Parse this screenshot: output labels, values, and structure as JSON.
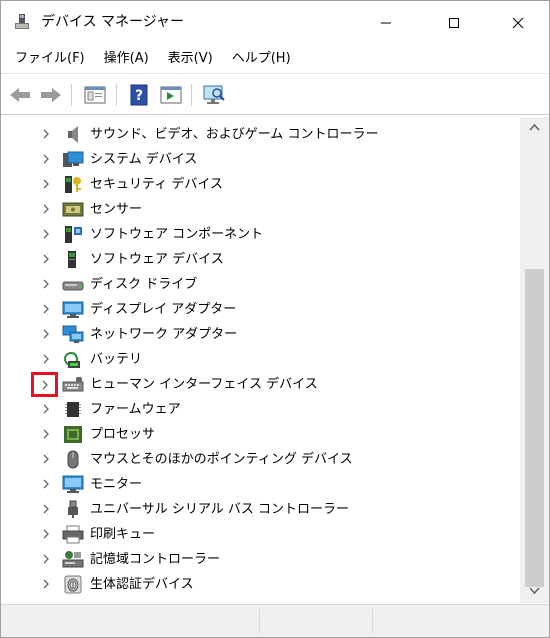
{
  "window": {
    "title": "デバイス マネージャー"
  },
  "menu": [
    {
      "label": "ファイル(F)"
    },
    {
      "label": "操作(A)"
    },
    {
      "label": "表示(V)"
    },
    {
      "label": "ヘルプ(H)"
    }
  ],
  "toolbar": {
    "buttons": [
      "back-icon",
      "forward-icon",
      "properties-icon",
      "help-icon",
      "run-icon",
      "scan-hardware-icon"
    ]
  },
  "tree": {
    "items": [
      {
        "label": "サウンド、ビデオ、およびゲーム コントローラー",
        "icon": "speaker-icon"
      },
      {
        "label": "システム デバイス",
        "icon": "system-device-icon"
      },
      {
        "label": "セキュリティ デバイス",
        "icon": "security-key-icon"
      },
      {
        "label": "センサー",
        "icon": "sensor-icon"
      },
      {
        "label": "ソフトウェア コンポーネント",
        "icon": "software-component-icon"
      },
      {
        "label": "ソフトウェア デバイス",
        "icon": "software-device-icon"
      },
      {
        "label": "ディスク ドライブ",
        "icon": "disk-drive-icon"
      },
      {
        "label": "ディスプレイ アダプター",
        "icon": "display-adapter-icon"
      },
      {
        "label": "ネットワーク アダプター",
        "icon": "network-adapter-icon"
      },
      {
        "label": "バッテリ",
        "icon": "battery-icon"
      },
      {
        "label": "ヒューマン インターフェイス デバイス",
        "icon": "hid-keyboard-icon",
        "highlighted": true
      },
      {
        "label": "ファームウェア",
        "icon": "firmware-chip-icon"
      },
      {
        "label": "プロセッサ",
        "icon": "processor-icon"
      },
      {
        "label": "マウスとそのほかのポインティング デバイス",
        "icon": "mouse-icon"
      },
      {
        "label": "モニター",
        "icon": "monitor-icon"
      },
      {
        "label": "ユニバーサル シリアル バス コントローラー",
        "icon": "usb-icon"
      },
      {
        "label": "印刷キュー",
        "icon": "printer-icon"
      },
      {
        "label": "記憶域コントローラー",
        "icon": "storage-controller-icon"
      },
      {
        "label": "生体認証デバイス",
        "icon": "fingerprint-icon"
      }
    ]
  },
  "colors": {
    "highlight_border": "#e81123",
    "scrollbar_thumb": "#cdcdcd"
  }
}
